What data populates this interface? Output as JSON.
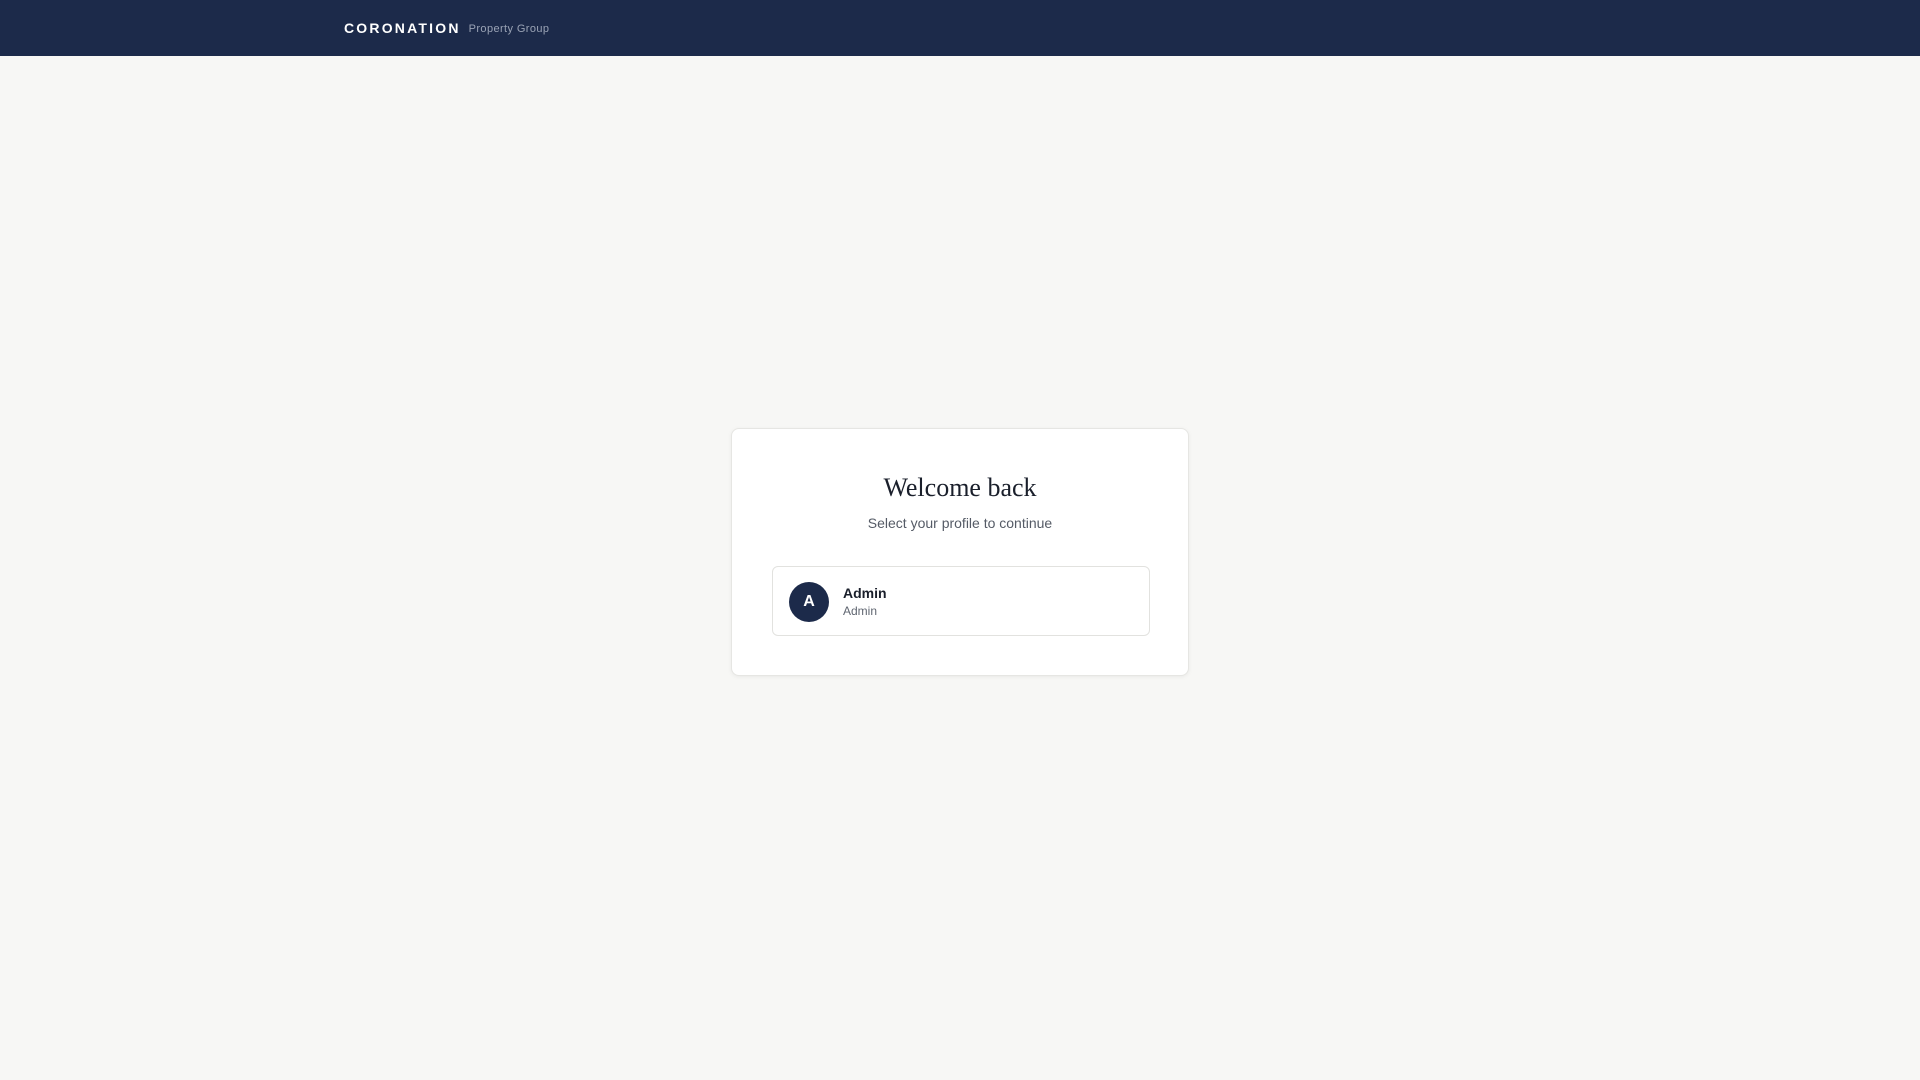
{
  "header": {
    "brand_name": "CORONATION",
    "brand_sub": "Property Group"
  },
  "login": {
    "title": "Welcome back",
    "subtitle": "Select your profile to continue",
    "profiles": [
      {
        "initial": "A",
        "name": "Admin",
        "role": "Admin"
      }
    ]
  },
  "colors": {
    "navy": "#1c2a4a",
    "page_bg": "#f7f7f5",
    "card_bg": "#ffffff"
  }
}
